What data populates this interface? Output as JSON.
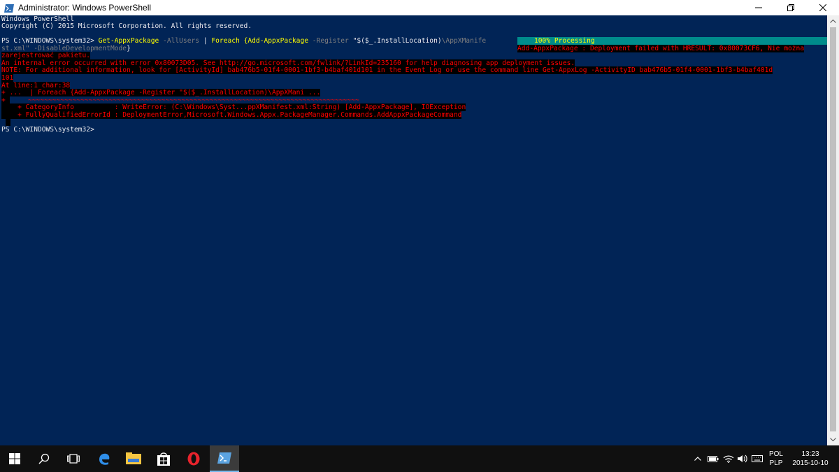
{
  "window": {
    "title": "Administrator: Windows PowerShell"
  },
  "console": {
    "lines": [
      "Windows PowerShell",
      "Copyright (C) 2015 Microsoft Corporation. All rights reserved.",
      ""
    ],
    "command": {
      "prompt": "PS C:\\WINDOWS\\system32> ",
      "cmd1": "Get-AppxPackage",
      "param1": " -AllUsers ",
      "pipe": "| ",
      "cmd2": "Foreach",
      "block_start": " {Add-AppxPackage",
      "param2": " -Register ",
      "str1": "\"$($_.InstallLocation)",
      "str_trunc": "\\AppXManife",
      "cont1": "st.xml\"",
      "param3": " -DisableDevelopmentMode",
      "block_end": "}"
    },
    "progress_text": "100% Processing",
    "deploy_fail": "Add-AppxPackage : Deployment failed with HRESULT: 0x80073CF6, Nie można",
    "errors": [
      "zarejestrować pakietu.",
      "An internal error occurred with error 0x80073D05. See http://go.microsoft.com/fwlink/?LinkId=235160 for help diagnosing app deployment issues.",
      "NOTE: For additional information, look for [ActivityId] bab476b5-01f4-0001-1bf3-b4baf401d101 in the Event Log or use the command line Get-AppxLog -ActivityID bab476b5-01f4-0001-1bf3-b4baf401d",
      "101",
      "At line:1 char:38",
      "+ ...  | Foreach {Add-AppxPackage -Register \"$($_.InstallLocation)\\AppXMani ...",
      "+ ",
      "    + CategoryInfo          : WriteError: (C:\\Windows\\Syst...ppXManifest.xml:String) [Add-AppxPackage], IOException",
      "    + FullyQualifiedErrorId : DeploymentError,Microsoft.Windows.Appx.PackageManager.Commands.AddAppxPackageCommand"
    ],
    "tildes": "~~~~~~~~~~~~~~~~~~~~~~~~~~~~~~~~~~~~~~~~~~~~~~~~~~~~~~~~~~~~~~~~~~~~~~~~~~~~~~~~~~",
    "final_prompt": "PS C:\\WINDOWS\\system32>"
  },
  "taskbar": {
    "buttons": [
      "start-icon",
      "search-icon",
      "task-view-icon",
      "edge-icon",
      "file-explorer-icon",
      "store-icon",
      "opera-icon",
      "powershell-icon"
    ],
    "lang_top": "POL",
    "lang_bottom": "PLP",
    "time": "13:23",
    "date": "2015-10-10"
  },
  "colors": {
    "console_bg": "#012456",
    "error_fg": "#ff0000",
    "command_fg": "#ffff00",
    "param_fg": "#7f7f7f",
    "progress_bg": "#008b8b"
  }
}
